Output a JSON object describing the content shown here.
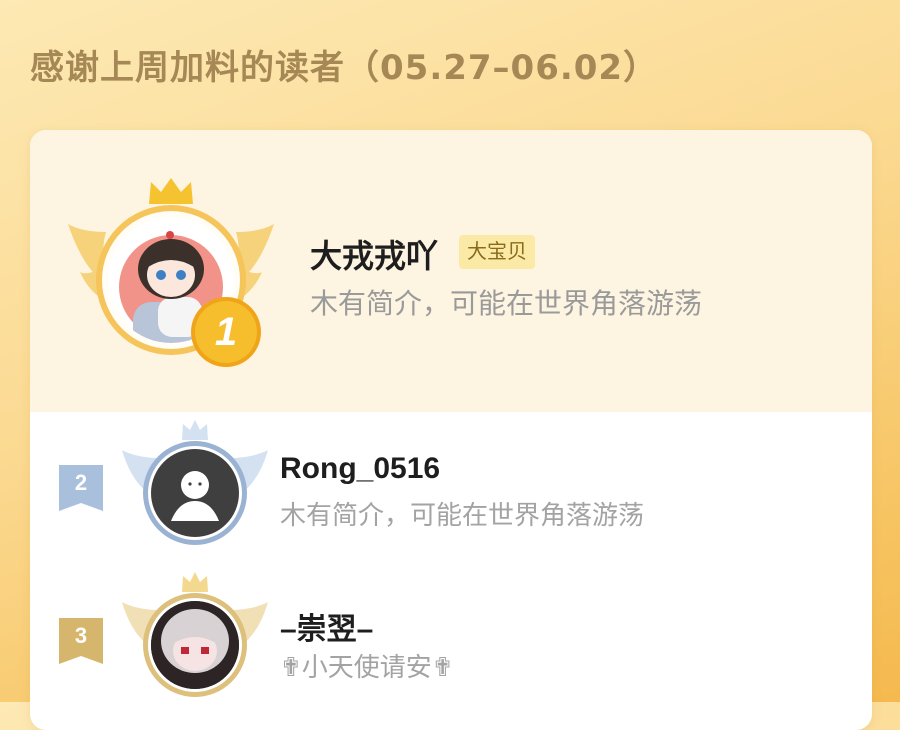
{
  "header": {
    "title": "感谢上周加料的读者（05.27–06.02）"
  },
  "readers": [
    {
      "rank": "1",
      "name": "大戎戎吖",
      "tag": "大宝贝",
      "bio": "木有简介，可能在世界角落游荡"
    },
    {
      "rank": "2",
      "name": "Rong_0516",
      "bio": "木有简介，可能在世界角落游荡"
    },
    {
      "rank": "3",
      "name": "–崇翌–",
      "bio": "✟小天使请安✟"
    }
  ],
  "colors": {
    "gold": "#f3b21c",
    "silver": "#a9c0dd",
    "bronze": "#d6b56c",
    "title": "#a58855"
  }
}
